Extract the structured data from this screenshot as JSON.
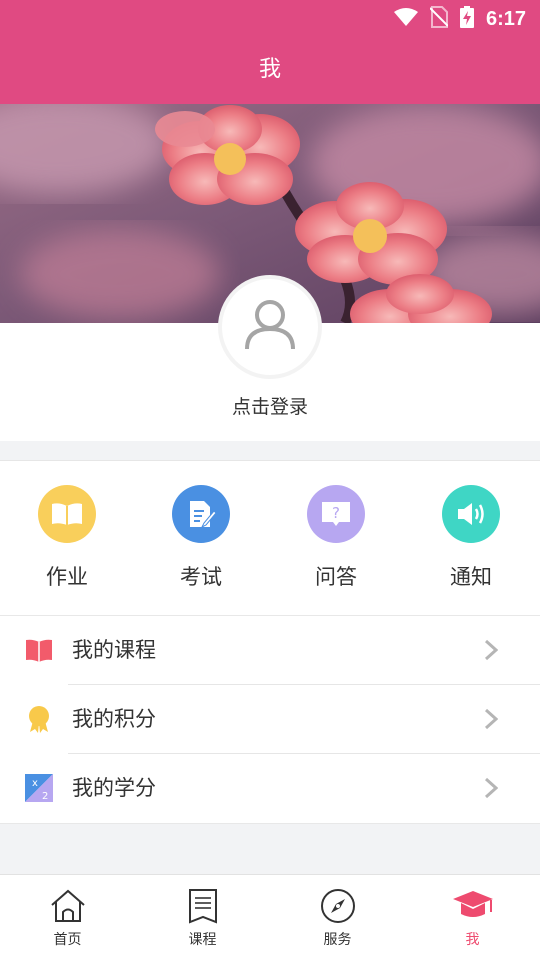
{
  "status": {
    "time": "6:17"
  },
  "header": {
    "title": "我"
  },
  "profile": {
    "login_text": "点击登录"
  },
  "quick_actions": [
    {
      "label": "作业",
      "icon": "book-icon",
      "color": "#f9cf5b"
    },
    {
      "label": "考试",
      "icon": "exam-paper-icon",
      "color": "#4a90e2"
    },
    {
      "label": "问答",
      "icon": "question-bubble-icon",
      "color": "#b7a7f1"
    },
    {
      "label": "通知",
      "icon": "speaker-icon",
      "color": "#3fd6c5"
    }
  ],
  "menu": [
    {
      "label": "我的课程",
      "icon": "open-book-icon"
    },
    {
      "label": "我的积分",
      "icon": "medal-icon"
    },
    {
      "label": "我的学分",
      "icon": "credit-icon"
    }
  ],
  "tabs": [
    {
      "label": "首页",
      "icon": "home-icon"
    },
    {
      "label": "课程",
      "icon": "list-icon"
    },
    {
      "label": "服务",
      "icon": "compass-icon"
    },
    {
      "label": "我",
      "icon": "graduation-cap-icon",
      "active": true
    }
  ],
  "colors": {
    "primary": "#e04a82",
    "active_tab": "#ee4b6f"
  }
}
